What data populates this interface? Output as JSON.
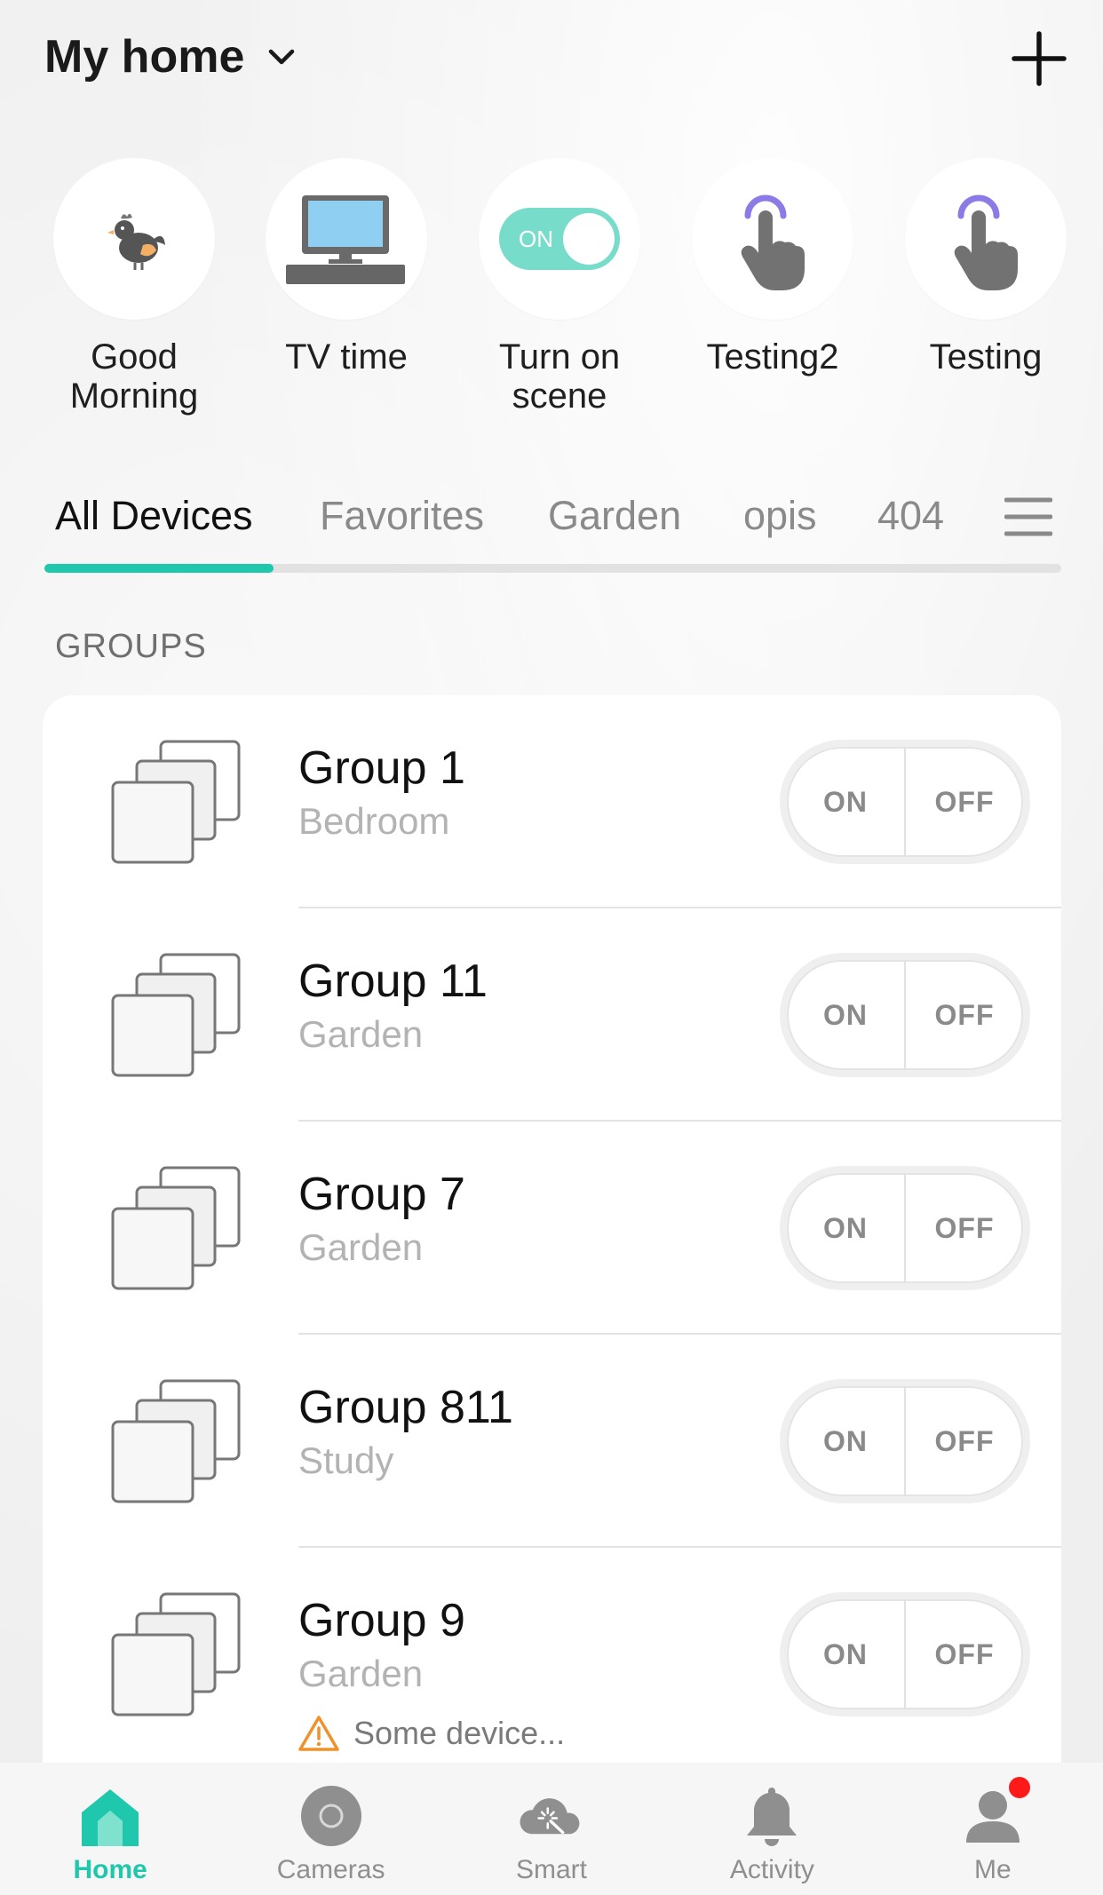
{
  "header": {
    "title": "My home"
  },
  "scenes": [
    {
      "label": "Good Morning",
      "icon": "rooster-icon"
    },
    {
      "label": "TV time",
      "icon": "tv-icon"
    },
    {
      "label": "Turn on scene",
      "icon": "switch-on-icon",
      "switch_text": "ON"
    },
    {
      "label": "Testing2",
      "icon": "tap-hand-icon"
    },
    {
      "label": "Testing",
      "icon": "tap-hand-icon"
    }
  ],
  "tabs": [
    "All Devices",
    "Favorites",
    "Garden",
    "opis",
    "404"
  ],
  "active_tab": "All Devices",
  "section_label": "GROUPS",
  "groups": [
    {
      "name": "Group 1",
      "room": "Bedroom",
      "on_label": "ON",
      "off_label": "OFF"
    },
    {
      "name": "Group 11",
      "room": "Garden",
      "on_label": "ON",
      "off_label": "OFF"
    },
    {
      "name": "Group 7",
      "room": "Garden",
      "on_label": "ON",
      "off_label": "OFF"
    },
    {
      "name": "Group 811",
      "room": "Study",
      "on_label": "ON",
      "off_label": "OFF"
    },
    {
      "name": "Group 9",
      "room": "Garden",
      "on_label": "ON",
      "off_label": "OFF",
      "warning": "Some device..."
    }
  ],
  "nav": [
    {
      "label": "Home",
      "icon": "home-icon"
    },
    {
      "label": "Cameras",
      "icon": "camera-icon"
    },
    {
      "label": "Smart",
      "icon": "smart-cloud-icon"
    },
    {
      "label": "Activity",
      "icon": "bell-icon"
    },
    {
      "label": "Me",
      "icon": "person-icon"
    }
  ],
  "active_nav": "Home",
  "colors": {
    "accent": "#1fc8ad",
    "notification": "#ff1a1a",
    "warning": "#f0922b"
  }
}
